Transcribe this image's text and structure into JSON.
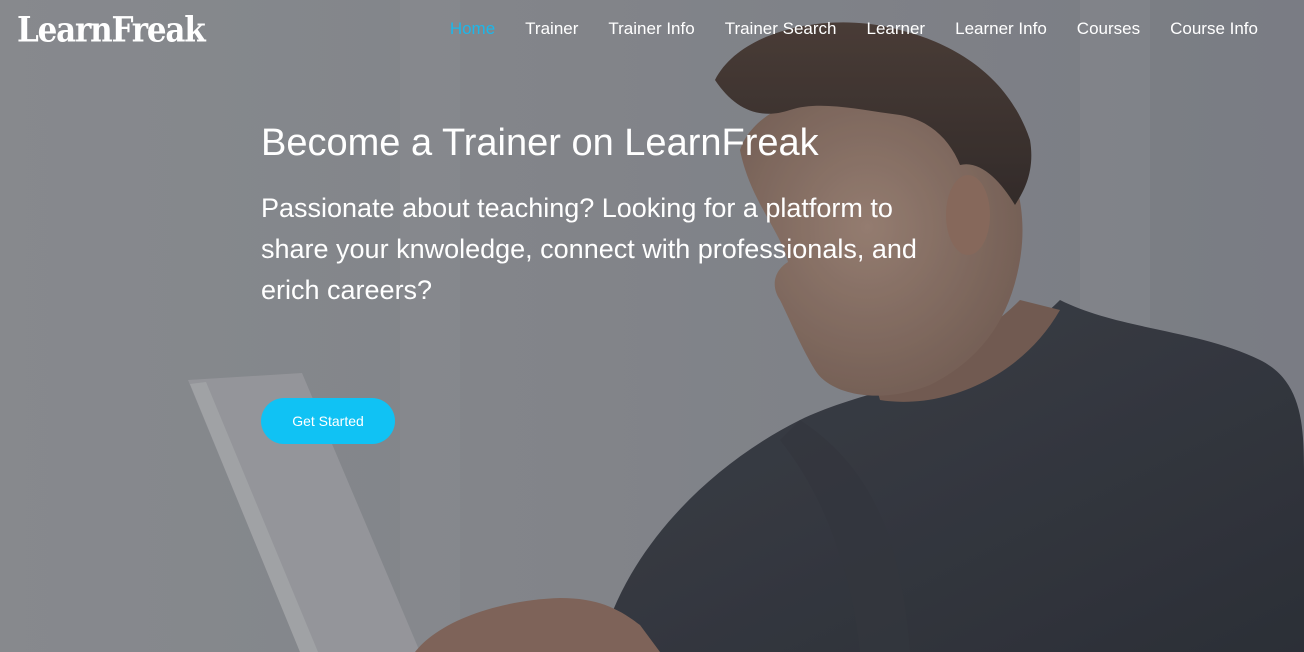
{
  "brand": {
    "logo_text": "LearnFreak"
  },
  "nav": {
    "items": [
      {
        "label": "Home",
        "active": true
      },
      {
        "label": "Trainer",
        "active": false
      },
      {
        "label": "Trainer Info",
        "active": false
      },
      {
        "label": "Trainer Search",
        "active": false
      },
      {
        "label": "Learner",
        "active": false
      },
      {
        "label": "Learner Info",
        "active": false
      },
      {
        "label": "Courses",
        "active": false
      },
      {
        "label": "Course Info",
        "active": false
      }
    ]
  },
  "hero": {
    "title": "Become a Trainer on LearnFreak",
    "subtitle": "Passionate about teaching? Looking for a platform to share your knwoledge, connect with professionals, and erich careers?",
    "cta_label": "Get Started",
    "background_image": "man-smiling-at-laptop"
  },
  "colors": {
    "accent": "#1cb7ea",
    "button": "#10c2f4",
    "text": "#ffffff"
  }
}
